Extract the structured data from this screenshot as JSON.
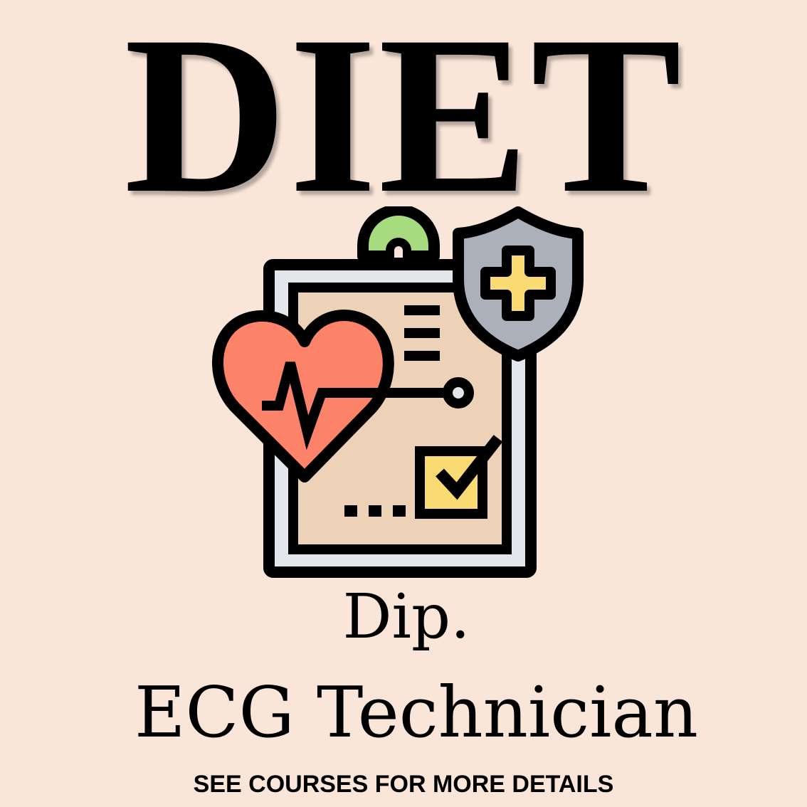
{
  "poster": {
    "brand": "DIET",
    "subtitle_line1": "Dip.",
    "subtitle_line2": "ECG Technician",
    "cta": "SEE COURSES FOR MORE DETAILS"
  },
  "icon": {
    "name": "medical-clipboard-icon",
    "parts": [
      "clipboard-icon",
      "heart-pulse-icon",
      "shield-plus-icon",
      "checkbox-icon"
    ]
  },
  "colors": {
    "background": "#FAE5D9",
    "text": "#000000",
    "clipboard_frame": "#E3E7EC",
    "paper": "#EED2B8",
    "heart": "#FC8269",
    "shield": "#ABB0BB",
    "cross": "#FADA73",
    "checkbox": "#FADA73",
    "clip_ring": "#A6DB80"
  }
}
